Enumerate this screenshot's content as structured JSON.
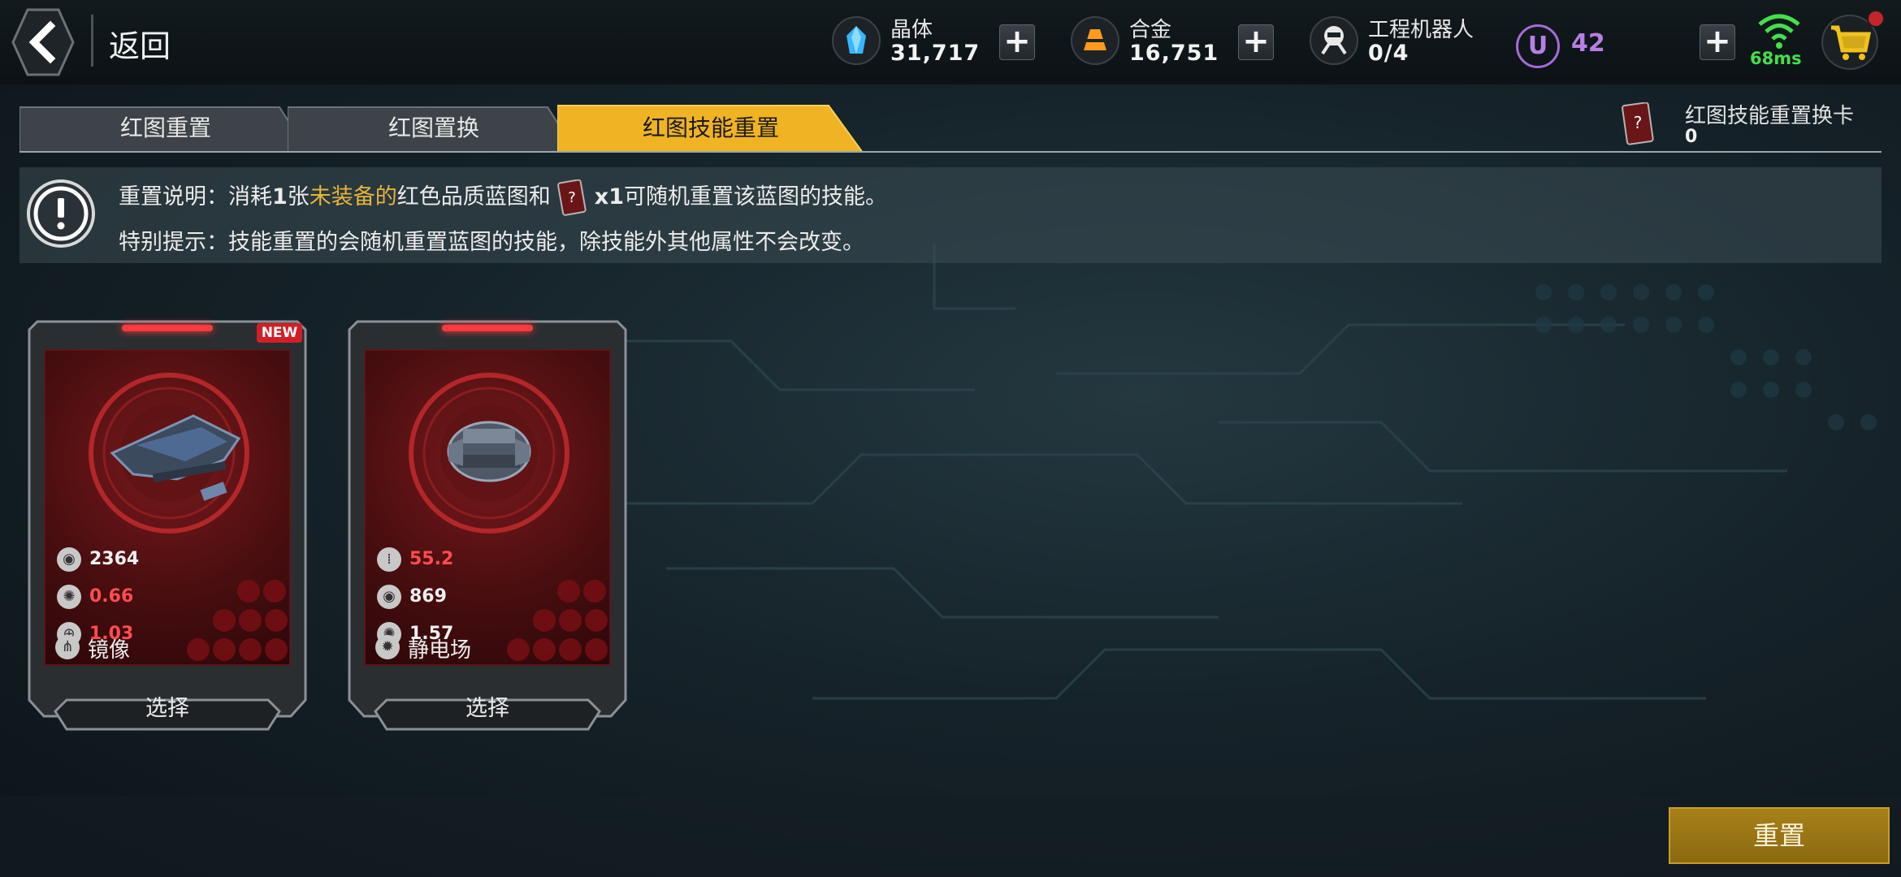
{
  "header": {
    "back_label": "返回"
  },
  "resources": [
    {
      "name": "晶体",
      "value": "31,717",
      "icon": "crystal-icon"
    },
    {
      "name": "合金",
      "value": "16,751",
      "icon": "alloy-icon"
    },
    {
      "name": "工程机器人",
      "value": "0/4",
      "icon": "robot-icon"
    }
  ],
  "u_currency": {
    "badge": "U",
    "value": "42"
  },
  "network": {
    "ping": "68ms"
  },
  "tabs": [
    {
      "label": "红图重置",
      "active": false
    },
    {
      "label": "红图置换",
      "active": false
    },
    {
      "label": "红图技能重置",
      "active": true
    }
  ],
  "card_counter": {
    "name": "红图技能重置换卡",
    "value": "0"
  },
  "info": {
    "line1_prefix": "重置说明：消耗",
    "line1_count": "1",
    "line1_unit": "张",
    "line1_highlight": "未装备的",
    "line1_mid": "红色品质蓝图和",
    "line1_qty": "x1",
    "line1_suffix": "可随机重置该蓝图的技能。",
    "line2": "特别提示：技能重置的会随机重置蓝图的技能，除技能外其他属性不会改变。"
  },
  "blueprints": [
    {
      "new_badge": "NEW",
      "stats": [
        {
          "icon": "durability-icon",
          "value": "2364",
          "color": "white"
        },
        {
          "icon": "cooldown-icon",
          "value": "0.66",
          "color": "red"
        },
        {
          "icon": "crosshair-icon",
          "value": "1.03",
          "color": "red"
        }
      ],
      "skill": {
        "icon": "mirror-skill-icon",
        "label": "镜像"
      },
      "select_label": "选择"
    },
    {
      "new_badge": "",
      "stats": [
        {
          "icon": "ammo-icon",
          "value": "55.2",
          "color": "red"
        },
        {
          "icon": "durability-icon",
          "value": "869",
          "color": "white"
        },
        {
          "icon": "cooldown-icon",
          "value": "1.57",
          "color": "white"
        }
      ],
      "skill": {
        "icon": "static-field-skill-icon",
        "label": "静电场"
      },
      "select_label": "选择"
    }
  ],
  "reset_button": "重置",
  "colors": {
    "accent_gold": "#e6b43c",
    "tab_active": "#f0b323",
    "stat_red": "#ff4c52",
    "ping_green": "#43e04a",
    "u_purple": "#b67fe6"
  }
}
